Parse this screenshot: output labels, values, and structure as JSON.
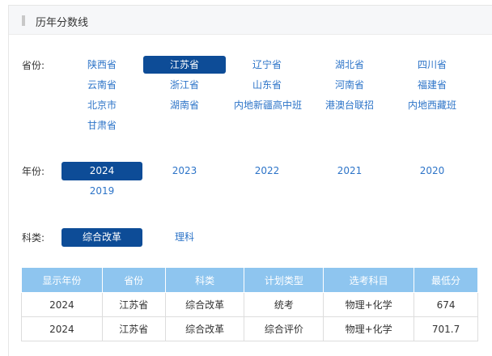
{
  "title": "历年分数线",
  "province": {
    "label": "省份:",
    "options": [
      "陕西省",
      "江苏省",
      "辽宁省",
      "湖北省",
      "四川省",
      "云南省",
      "浙江省",
      "山东省",
      "河南省",
      "福建省",
      "北京市",
      "湖南省",
      "内地新疆高中班",
      "港澳台联招",
      "内地西藏班",
      "甘肃省"
    ],
    "selected": "江苏省"
  },
  "year": {
    "label": "年份:",
    "options": [
      "2024",
      "2023",
      "2022",
      "2021",
      "2020",
      "2019"
    ],
    "selected": "2024"
  },
  "subject": {
    "label": "科类:",
    "options": [
      "综合改革",
      "理科"
    ],
    "selected": "综合改革"
  },
  "table": {
    "headers": [
      "显示年份",
      "省份",
      "科类",
      "计划类型",
      "选考科目",
      "最低分"
    ],
    "rows": [
      [
        "2024",
        "江苏省",
        "综合改革",
        "统考",
        "物理+化学",
        "674"
      ],
      [
        "2024",
        "江苏省",
        "综合改革",
        "综合评价",
        "物理+化学",
        "701.7"
      ]
    ]
  },
  "colors": {
    "accent": "#0d4c97",
    "link": "#2d74c8",
    "table_header": "#8ec5ef"
  }
}
